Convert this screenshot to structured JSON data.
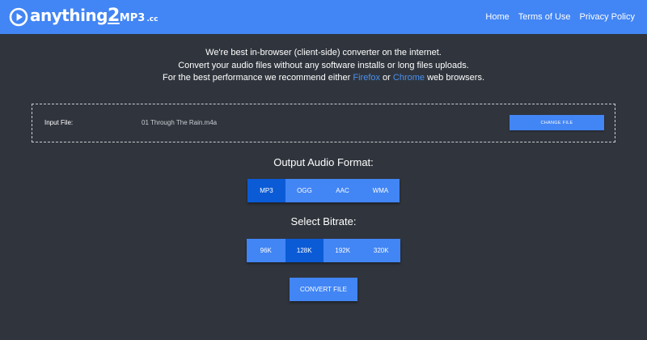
{
  "header": {
    "logo": {
      "word": "anything",
      "two": "2",
      "mp3": "MP3",
      "tld": ".cc"
    },
    "nav": [
      {
        "label": "Home"
      },
      {
        "label": "Terms of Use"
      },
      {
        "label": "Privacy Policy"
      }
    ],
    "bar_color": "#4285f4"
  },
  "intro": {
    "line1": "We're best in-browser (client-side) converter on the internet.",
    "line2": "Convert your audio files without any software installs or long files uploads.",
    "line3_before": "For the best performance we recommend either ",
    "link_firefox": "Firefox",
    "line3_mid": " or ",
    "link_chrome": "Chrome",
    "line3_after": " web browsers."
  },
  "input_file": {
    "label": "Input File:",
    "filename": "01 Through The Rain.m4a",
    "change_button": "CHANGE FILE"
  },
  "output_format": {
    "title": "Output Audio Format:",
    "options": [
      {
        "label": "MP3",
        "selected": true
      },
      {
        "label": "OGG",
        "selected": false
      },
      {
        "label": "AAC",
        "selected": false
      },
      {
        "label": "WMA",
        "selected": false
      }
    ]
  },
  "bitrate": {
    "title": "Select Bitrate:",
    "options": [
      {
        "label": "96K",
        "selected": false
      },
      {
        "label": "128K",
        "selected": true
      },
      {
        "label": "192K",
        "selected": false
      },
      {
        "label": "320K",
        "selected": false
      }
    ]
  },
  "convert_button": "CONVERT FILE",
  "colors": {
    "background": "#30353d",
    "accent": "#4285f4",
    "accent_active": "#0b5bd6",
    "link": "#4a90f0"
  }
}
